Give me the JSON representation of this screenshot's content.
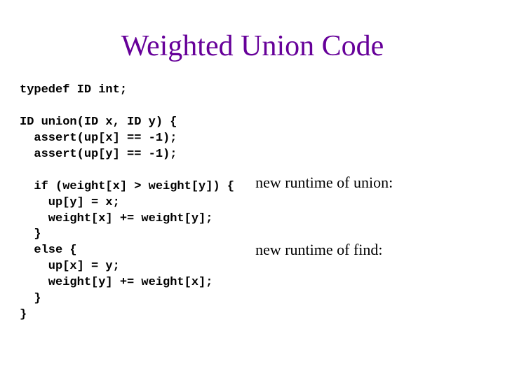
{
  "title": "Weighted Union Code",
  "code": "typedef ID int;\n\nID union(ID x, ID y) {\n  assert(up[x] == -1);\n  assert(up[y] == -1);\n\n  if (weight[x] > weight[y]) {\n    up[y] = x;\n    weight[x] += weight[y];\n  }\n  else {\n    up[x] = y;\n    weight[y] += weight[x];\n  }\n}",
  "note_union": "new runtime of union:",
  "note_find": "new runtime of find:"
}
